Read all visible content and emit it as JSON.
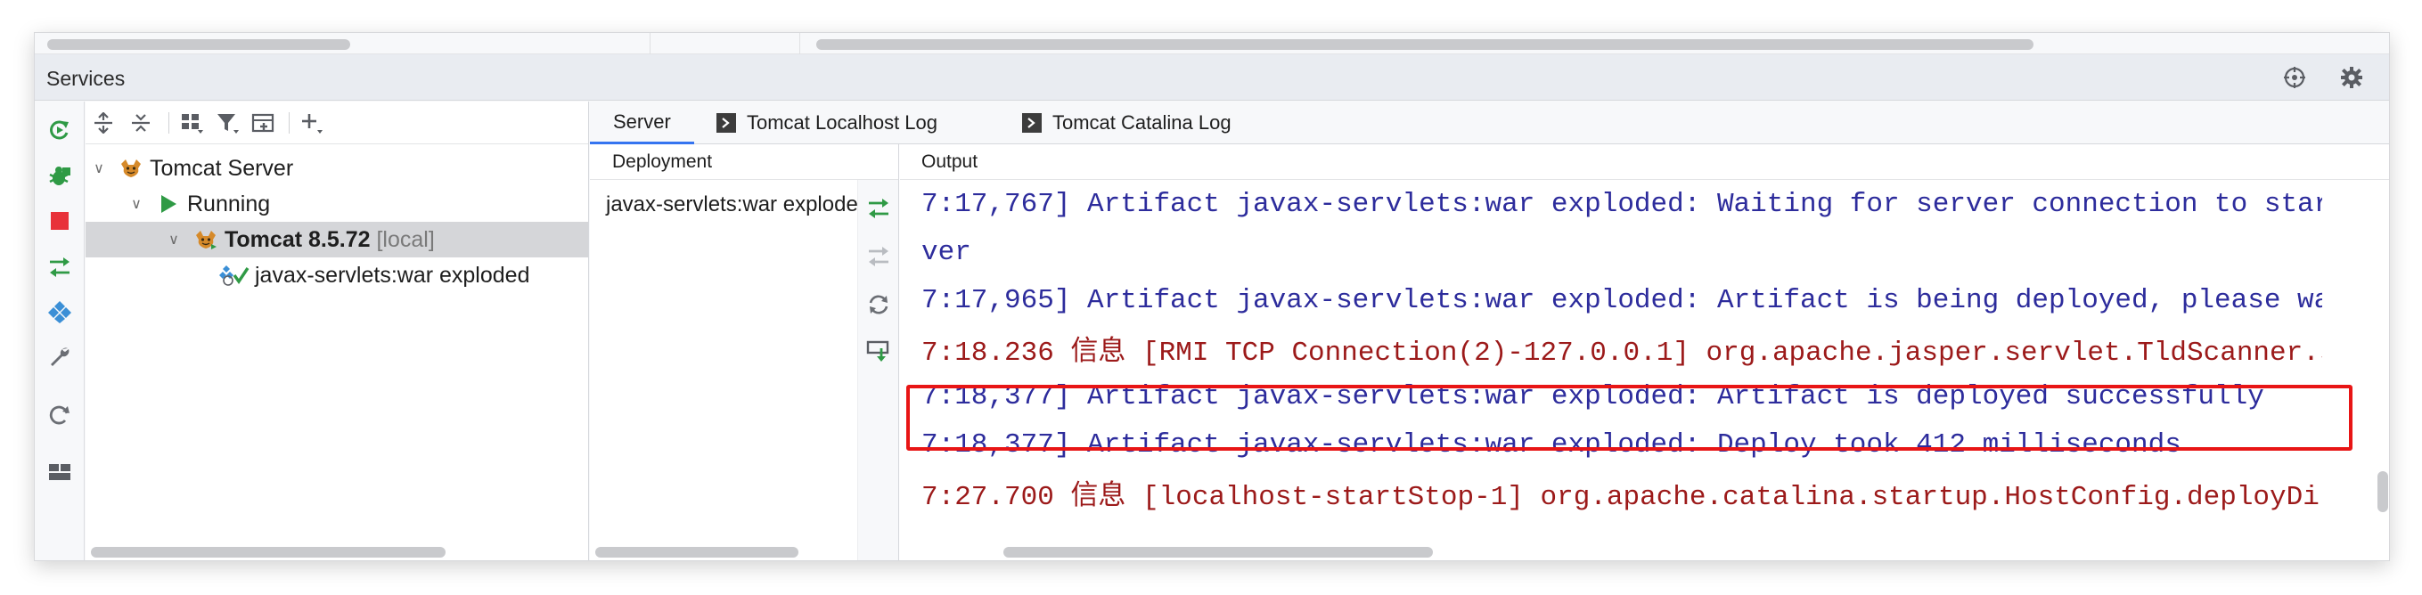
{
  "panel": {
    "title": "Services"
  },
  "colors": {
    "accent": "#3574f0",
    "run_green": "#2f9a45",
    "stop_red": "#e8323a",
    "highlight": "#e81515",
    "info_text": "#2d2c9c",
    "error_text": "#9c1a1a"
  },
  "left_toolbar": [
    {
      "name": "rerun-icon"
    },
    {
      "name": "debug-icon"
    },
    {
      "name": "stop-icon"
    },
    {
      "name": "deploy-icon"
    },
    {
      "name": "artifact-icon"
    },
    {
      "name": "wrench-icon"
    },
    {
      "name": "refresh-icon"
    },
    {
      "name": "layout-icon"
    }
  ],
  "tree": {
    "toolbar": [
      {
        "name": "expand-all-icon"
      },
      {
        "name": "collapse-all-icon"
      },
      {
        "name": "group-icon"
      },
      {
        "name": "filter-icon"
      },
      {
        "name": "new-tab-icon"
      },
      {
        "name": "add-icon"
      }
    ],
    "rows": [
      {
        "label": "Tomcat Server",
        "suffix": "",
        "level": 0,
        "icon": "tomcat-icon",
        "selected": false
      },
      {
        "label": "Running",
        "suffix": "",
        "level": 1,
        "icon": "run-icon",
        "selected": false
      },
      {
        "label": "Tomcat 8.5.72",
        "suffix": " [local]",
        "level": 2,
        "icon": "tomcat-icon",
        "selected": true
      },
      {
        "label": "javax-servlets:war exploded",
        "suffix": "",
        "level": 3,
        "icon": "artifact-deployed-icon",
        "selected": false
      }
    ]
  },
  "tabs": [
    {
      "label": "Server",
      "active": true
    },
    {
      "label": "Tomcat Localhost Log",
      "active": false
    },
    {
      "label": "Tomcat Catalina Log",
      "active": false
    }
  ],
  "deployment": {
    "header": "Deployment",
    "item": "javax-servlets:war exploded"
  },
  "output": {
    "header": "Output",
    "lines": [
      {
        "text": "7:17,767] Artifact javax-servlets:war exploded: Waiting for server connection to start artifact deployment...",
        "kind": "info"
      },
      {
        "text": "ver",
        "kind": "info"
      },
      {
        "text": "7:17,965] Artifact javax-servlets:war exploded: Artifact is being deployed, please wait...",
        "kind": "info"
      },
      {
        "text": "7:18.236 信息 [RMI TCP Connection(2)-127.0.0.1] org.apache.jasper.servlet.TldScanner.scanJars",
        "kind": "err"
      },
      {
        "text": "7:18,377] Artifact javax-servlets:war exploded: Artifact is deployed successfully",
        "kind": "info"
      },
      {
        "text": "7:18,377] Artifact javax-servlets:war exploded: Deploy took 412 milliseconds",
        "kind": "info"
      },
      {
        "text": "7:27.700 信息 [localhost-startStop-1] org.apache.catalina.startup.HostConfig.deployDirectory",
        "kind": "err"
      }
    ]
  }
}
